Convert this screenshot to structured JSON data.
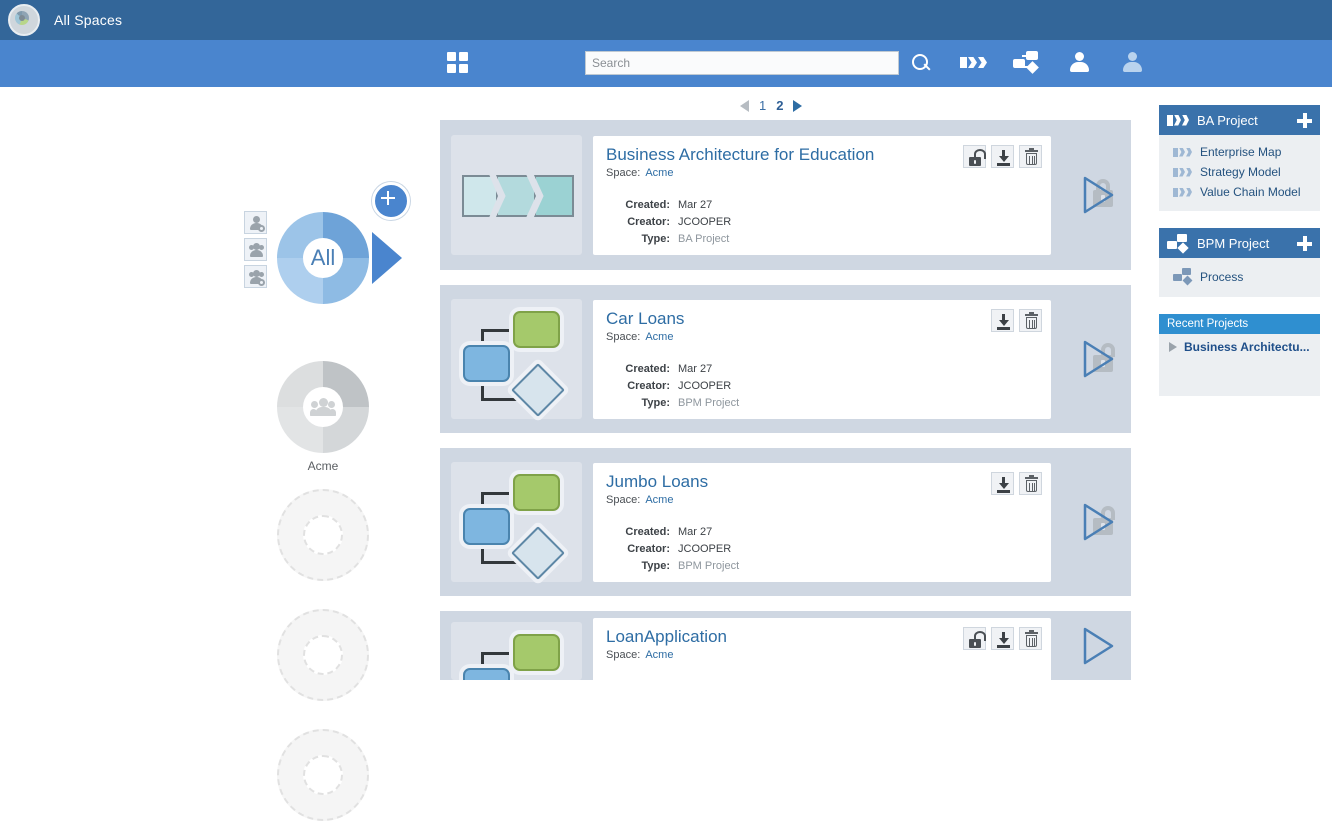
{
  "topbar": {
    "title": "All Spaces",
    "logo_icon": "space-logo-icon"
  },
  "toolbar": {
    "grid_icon": "grid-apps-icon",
    "search": {
      "placeholder": "Search",
      "value": "",
      "icon": "search-icon"
    },
    "icons": [
      {
        "name": "ba-project-icon",
        "label": "BA Project"
      },
      {
        "name": "bpm-project-icon",
        "label": "BPM Project"
      },
      {
        "name": "user-icon",
        "label": "User"
      },
      {
        "name": "users-icon",
        "label": "Users"
      }
    ]
  },
  "spaces": {
    "add_button_label": "+",
    "side_buttons": [
      {
        "name": "space-owner-icon",
        "label": "Owner"
      },
      {
        "name": "space-members-icon",
        "label": "Members"
      },
      {
        "name": "space-shared-icon",
        "label": "Shared"
      }
    ],
    "items": [
      {
        "label": "All",
        "type": "all"
      },
      {
        "label": "Acme",
        "type": "space"
      },
      {
        "label": "",
        "type": "empty"
      },
      {
        "label": "",
        "type": "empty"
      },
      {
        "label": "",
        "type": "empty"
      }
    ]
  },
  "pagination": {
    "prev": "◀",
    "next": "▶",
    "pages": [
      "1",
      "2"
    ],
    "active": "2"
  },
  "labels": {
    "space": "Space:",
    "created": "Created:",
    "creator": "Creator:",
    "type": "Type:"
  },
  "projects": [
    {
      "title": "Business Architecture for Education",
      "space": "Acme",
      "created": "Mar 27",
      "creator": "JCOOPER",
      "type": "BA Project",
      "thumb": "ba-chevrons-thumbnail",
      "locked": true,
      "actions": [
        "lock-icon",
        "download-icon",
        "trash-icon"
      ]
    },
    {
      "title": "Car Loans",
      "space": "Acme",
      "created": "Mar 27",
      "creator": "JCOOPER",
      "type": "BPM Project",
      "thumb": "bpm-diagram-thumbnail",
      "locked": false,
      "actions": [
        "download-icon",
        "trash-icon"
      ]
    },
    {
      "title": "Jumbo Loans",
      "space": "Acme",
      "created": "Mar 27",
      "creator": "JCOOPER",
      "type": "BPM Project",
      "thumb": "bpm-diagram-thumbnail",
      "locked": false,
      "actions": [
        "download-icon",
        "trash-icon"
      ]
    },
    {
      "title": "LoanApplication",
      "space": "Acme",
      "created": "",
      "creator": "",
      "type": "",
      "thumb": "bpm-diagram-thumbnail",
      "locked": true,
      "actions": [
        "lock-icon",
        "download-icon",
        "trash-icon"
      ]
    }
  ],
  "right_panel": {
    "ba": {
      "title": "BA Project",
      "add": "+",
      "items": [
        "Enterprise Map",
        "Strategy Model",
        "Value Chain Model"
      ]
    },
    "bpm": {
      "title": "BPM Project",
      "add": "+",
      "items": [
        "Process"
      ]
    },
    "recent": {
      "title": "Recent Projects",
      "items": [
        "Business Architectu..."
      ]
    }
  },
  "colors": {
    "topbar": "#336699",
    "toolbar": "#4a85ce",
    "panel_header": "#3a72ab",
    "recent_header": "#2f8fd0",
    "card_bg": "#cfd7e2",
    "link": "#2e6da4"
  }
}
